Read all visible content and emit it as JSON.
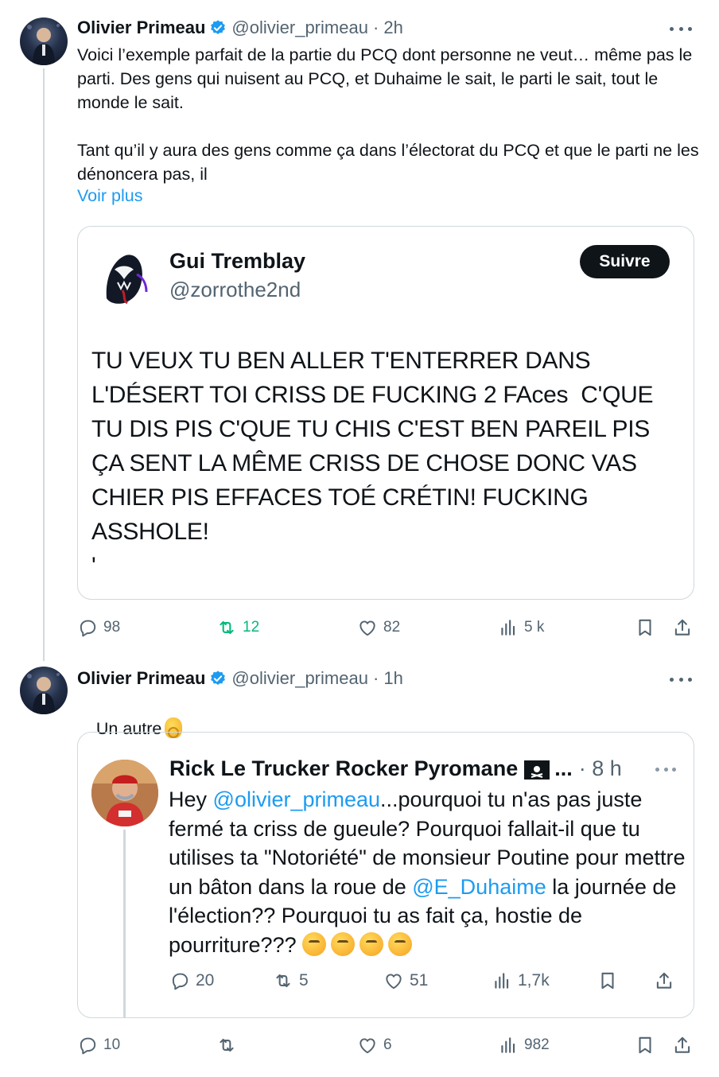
{
  "tweet1": {
    "author_name": "Olivier Primeau",
    "author_handle": "@olivier_primeau",
    "time": "· 2h",
    "text": "Voici l’exemple parfait de la partie du PCQ dont personne ne veut… même pas le parti. Des gens qui nuisent au PCQ, et Duhaime le sait, le parti le sait, tout le monde le sait.\n\nTant qu’il y aura des gens comme ça dans l’électorat du PCQ et que le parti ne les dénoncera pas, il",
    "see_more": "Voir plus",
    "quote": {
      "name": "Gui Tremblay",
      "name_display": "Gui Tremblay",
      "handle": "@zorrothe2nd",
      "follow_label": "Suivre",
      "text": "TU VEUX TU BEN ALLER T'ENTERRER DANS L'DÉSERT TOI CRISS DE FUCKING 2 FAces  C'QUE TU DIS PIS C'QUE TU CHIS C'EST BEN PAREIL PIS ÇA SENT LA MÊME CRISS DE CHOSE DONC VAS CHIER PIS EFFACES TOÉ CRÉTIN! FUCKING ASSHOLE!\n'"
    },
    "actions": {
      "replies": "98",
      "retweets": "12",
      "likes": "82",
      "views": "5 k"
    }
  },
  "tweet2": {
    "author_name": "Olivier Primeau",
    "author_handle": "@olivier_primeau",
    "time": "· 1h",
    "text": "Un autre",
    "quote": {
      "name": "Rick Le Trucker Rocker Pyromane",
      "ellipsis": "...",
      "time": "· 8 h",
      "text_before_mention1": "Hey ",
      "mention1": "@olivier_primeau",
      "text_mid": "...pourquoi tu n'as pas juste fermé ta criss de gueule? Pourquoi fallait-il que tu utilises ta \"Notoriété\" de monsieur Poutine pour mettre un bâton dans la roue de ",
      "mention2": "@E_Duhaime",
      "text_after": " la journée de l'élection?? Pourquoi tu as fait ça, hostie de pourriture??? ",
      "actions": {
        "replies": "20",
        "retweets": "5",
        "likes": "51",
        "views": "1,7k"
      }
    },
    "actions": {
      "replies": "10",
      "retweets": "",
      "likes": "6",
      "views": "982"
    }
  },
  "colors": {
    "accent": "#1d9bf0",
    "retweet_active": "#00ba7c",
    "muted": "#536471",
    "border": "#cfd9de"
  }
}
